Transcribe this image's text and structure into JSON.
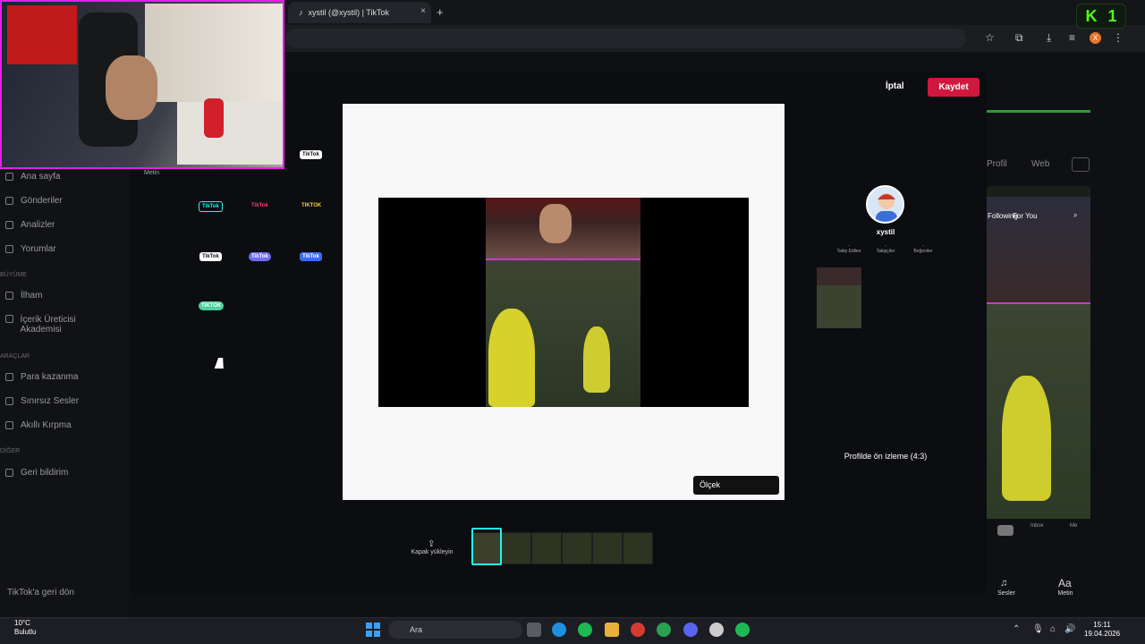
{
  "browser": {
    "tab_title": "xystil (@xystil) | TikTok",
    "new_tab": "+",
    "tab_close": "×",
    "window_controls": "—  □",
    "kick_label": "K",
    "kick_count": "1",
    "profile_initial": "X"
  },
  "modal": {
    "cancel_label": "İptal",
    "save_label": "Kaydet",
    "sticker_section_label": "Metin",
    "scale_label": "Ölçek",
    "upload_cover_label": "Kapak yükleyin",
    "profile_preview_label": "Profilde ön izleme (4:3)"
  },
  "sidebar": {
    "items": [
      {
        "label": "Ana sayfa"
      },
      {
        "label": "Gönderiler"
      },
      {
        "label": "Analizler"
      },
      {
        "label": "Yorumlar"
      },
      {
        "label": "İlham"
      },
      {
        "label": "İçerik Üreticisi Akademisi"
      },
      {
        "label": "Para kazanma"
      },
      {
        "label": "Sınırsız Sesler"
      },
      {
        "label": "Akıllı Kırpma"
      },
      {
        "label": "Geri bildirim"
      }
    ],
    "sections": [
      "BÜYÜME",
      "ARAÇLAR",
      "DİĞER"
    ],
    "back_label": "TikTok'a geri dön"
  },
  "stickers": [
    "TikTok",
    "TikTok",
    "TikTok",
    "TIKTOK",
    "TikTok",
    "TikTok",
    "TikTok",
    "TIKTOK"
  ],
  "preview": {
    "username": "xystil",
    "stats": [
      "Takip Edilen",
      "Takipçiler",
      "Beğeniler"
    ],
    "stat_values": [
      "-",
      "-",
      "-"
    ]
  },
  "phone": {
    "tabs": [
      "Profil",
      "Web"
    ],
    "feed_tabs": [
      "Following",
      "For You"
    ],
    "bottom": [
      "Sesler",
      "Metin"
    ],
    "inbox": "Inbox",
    "me": "Me"
  },
  "taskbar": {
    "temperature": "10°C",
    "condition": "Bulutlu",
    "search_placeholder": "Ara",
    "time": "15:11",
    "date": "19.04.2026"
  },
  "colors": {
    "accent": "#d0183f",
    "kick_green": "#53fc18",
    "tiktok_cyan": "#25f4ee",
    "webcam_border": "#e61fe6"
  }
}
